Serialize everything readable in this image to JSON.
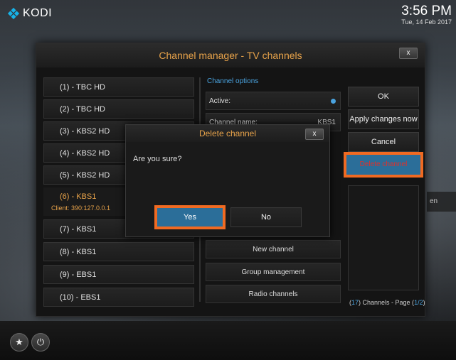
{
  "app": {
    "logo_text": "KODI"
  },
  "clock": {
    "time": "3:56 PM",
    "date": "Tue, 14 Feb 2017"
  },
  "dialog": {
    "title": "Channel manager - TV channels",
    "close_label": "x",
    "channels": [
      {
        "label": "(1) - TBC HD"
      },
      {
        "label": "(2) - TBC HD"
      },
      {
        "label": "(3) - KBS2 HD"
      },
      {
        "label": "(4) - KBS2 HD"
      },
      {
        "label": "(5) - KBS2 HD"
      },
      {
        "label": "(6) - KBS1",
        "client": "Client: 390:127.0.0.1"
      },
      {
        "label": "(7) - KBS1"
      },
      {
        "label": "(8) - KBS1"
      },
      {
        "label": "(9) - EBS1"
      },
      {
        "label": "(10) - EBS1"
      }
    ],
    "options": {
      "title": "Channel options",
      "active_label": "Active:",
      "channel_name_label": "Channel name:",
      "channel_name_value": "KBS1",
      "new_channel": "New channel",
      "group_management": "Group management",
      "radio_channels": "Radio channels"
    },
    "side_buttons": {
      "ok": "OK",
      "apply": "Apply changes now",
      "cancel": "Cancel",
      "delete": "Delete channel"
    },
    "channels_page": {
      "count": "17",
      "prefix_open": "(",
      "count_suffix": ") Channels - Page (",
      "page": "1/2",
      "close": ")"
    }
  },
  "confirm": {
    "title": "Delete channel",
    "message": "Are you sure?",
    "yes": "Yes",
    "no": "No",
    "close_label": "x"
  },
  "right_card": {
    "text": "en"
  },
  "bottom": {
    "favourites_icon": "star-icon",
    "power_icon": "power-icon"
  },
  "colors": {
    "accent_orange": "#e8a34a",
    "accent_blue": "#4aa3df",
    "highlight": "#f06a22",
    "button_blue": "#2b6e99"
  }
}
